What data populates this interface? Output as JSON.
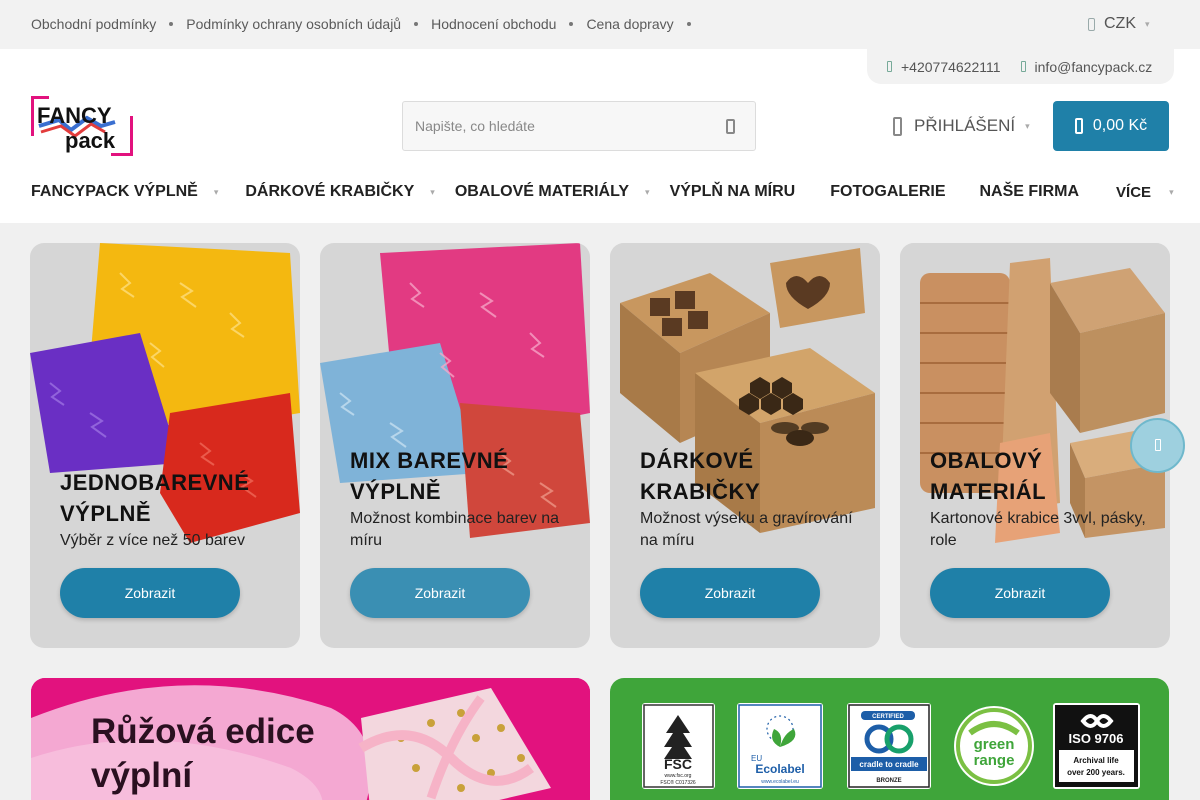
{
  "topbar": {
    "links": [
      "Obchodní podmínky",
      "Podmínky ochrany osobních údajů",
      "Hodnocení obchodu",
      "Cena dopravy"
    ],
    "currency": "CZK"
  },
  "contact": {
    "phone": "+420774622111",
    "email": "info@fancypack.cz"
  },
  "logo": {
    "line1": "FANCY",
    "line2": "pack"
  },
  "search": {
    "placeholder": "Napište, co hledáte"
  },
  "account": {
    "login_label": "PŘIHLÁŠENÍ"
  },
  "cart": {
    "total": "0,00 Kč"
  },
  "nav": {
    "items": [
      "FANCYPACK VÝPLNĚ",
      "DÁRKOVÉ KRABIČKY",
      "OBALOVÉ MATERIÁLY",
      "VÝPLŇ NA MÍRU",
      "FOTOGALERIE",
      "NAŠE FIRMA",
      "VÍCE"
    ]
  },
  "cards": [
    {
      "title": "JEDNOBAREVNÉ VÝPLNĚ",
      "desc": "Výběr z více než 50 barev",
      "button": "Zobrazit"
    },
    {
      "title": "MIX BAREVNÉ VÝPLNĚ",
      "desc": "Možnost kombinace barev na míru",
      "button": "Zobrazit"
    },
    {
      "title": "DÁRKOVÉ KRABIČKY",
      "desc": "Možnost výseku a gravírování na míru",
      "button": "Zobrazit"
    },
    {
      "title": "OBALOVÝ MATERIÁL",
      "desc": "Kartonové krabice 3vvl, pásky, role",
      "button": "Zobrazit"
    }
  ],
  "banners": {
    "pink_title": "Růžová edice výplní",
    "certs": [
      {
        "name": "fsc-logo",
        "label": "FSC",
        "sub": "www.fsc.org",
        "code": "FSC® C017326"
      },
      {
        "name": "eu-ecolabel-logo",
        "label": "Ecolabel",
        "sub": "EU",
        "code": "www.ecolabel.eu"
      },
      {
        "name": "cradle-to-cradle-logo",
        "label": "cradle to cradle",
        "sub": "CERTIFIED",
        "code": "BRONZE"
      },
      {
        "name": "green-range-logo",
        "label": "green range",
        "sub": "",
        "code": ""
      },
      {
        "name": "iso-9706-logo",
        "label": "ISO 9706",
        "sub": "Archival life",
        "code": "over 200 years."
      }
    ]
  },
  "colors": {
    "accent": "#1f80a8",
    "topbar_bg": "#f2f2f2",
    "card_bg": "#d6d6d6",
    "pink_banner": "#e2127e",
    "green_banner": "#3fa53a"
  }
}
